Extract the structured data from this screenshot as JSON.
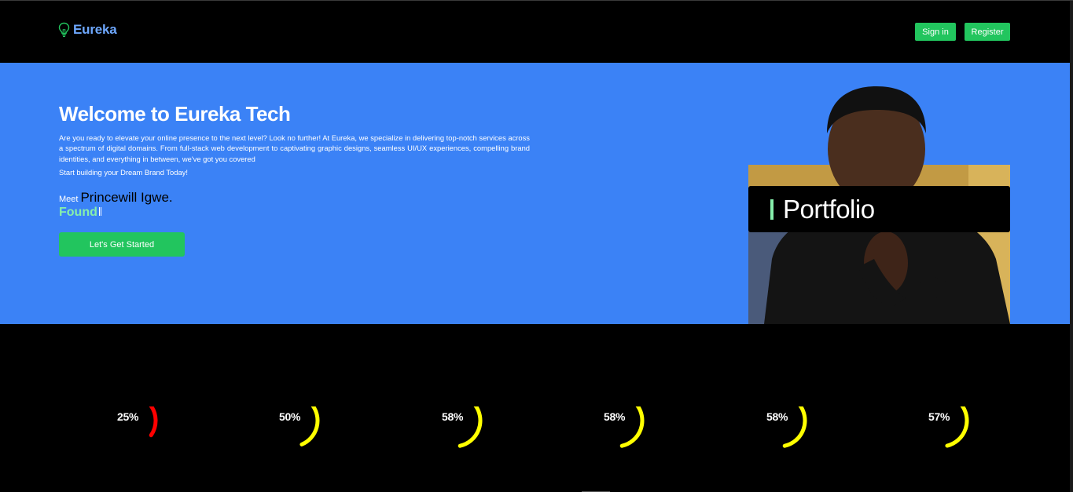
{
  "header": {
    "brand": "Eureka",
    "signin_label": "Sign in",
    "register_label": "Register",
    "accent": "#22c55e",
    "brand_color": "#6ea8fe"
  },
  "hero": {
    "title": "Welcome to Eureka Tech",
    "description": "Are you ready to elevate your online presence to the next level? Look no further! At Eureka, we specialize in delivering top-notch services across a spectrum of digital domains. From full-stack web development to captivating graphic designs, seamless UI/UX experiences, compelling brand identities, and everything in between, we've got you covered",
    "subtitle": "Start building your Dream Brand Today!",
    "meet_label": "Meet",
    "meet_name": "Princewill Igwe.",
    "typed_word": "Found",
    "cta_label": "Let's Get Started",
    "background": "#3b82f6"
  },
  "portfolio": {
    "label": "Portfolio"
  },
  "stats": [
    {
      "value": 25,
      "label": "25%",
      "color": "#ff0000"
    },
    {
      "value": 50,
      "label": "50%",
      "color": "#ffff00"
    },
    {
      "value": 58,
      "label": "58%",
      "color": "#ffff00"
    },
    {
      "value": 58,
      "label": "58%",
      "color": "#ffff00"
    },
    {
      "value": 58,
      "label": "58%",
      "color": "#ffff00"
    },
    {
      "value": 57,
      "label": "57%",
      "color": "#ffff00"
    }
  ]
}
